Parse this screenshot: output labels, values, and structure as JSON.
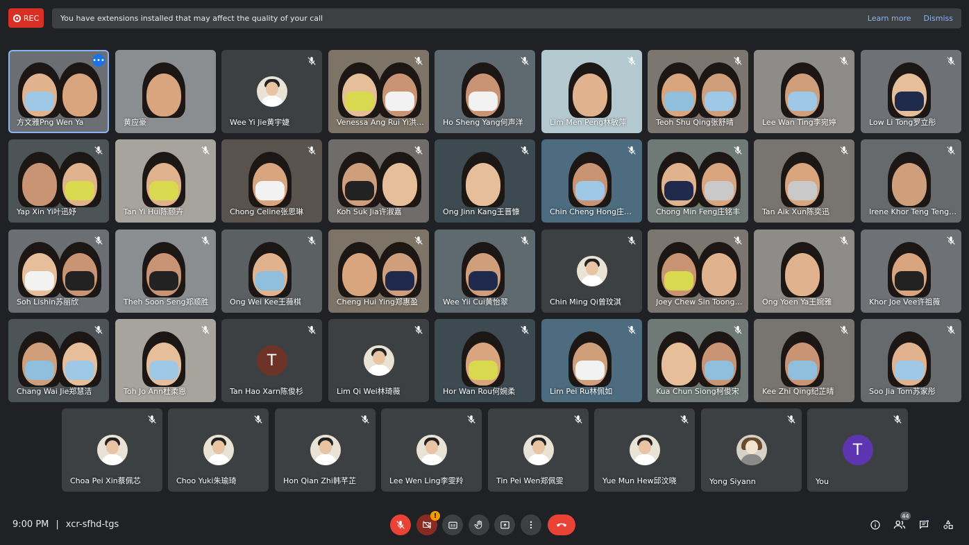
{
  "recording": {
    "label": "REC"
  },
  "banner": {
    "message": "You have extensions installed that may affect the quality of your call",
    "learn_more": "Learn more",
    "dismiss": "Dismiss"
  },
  "participants": [
    "方文雅Png Wen Ya",
    "黄应豪",
    "Wee Yi Jie黄宇婕",
    "Venessa Ang Rui Yi洪芮怡",
    "Ho Sheng Yang何声洋",
    "Lim Men Peng林敏萍",
    "Teoh Shu Qing张舒晴",
    "Lee Wan Ting李宛婷",
    "Low Li Tong罗立彤",
    "Yap Xin Yi叶迅妤",
    "Tan Yi Hui陈颐卉",
    "Chong Celine张思琳",
    "Koh Suk Jia许淑嘉",
    "Ong Jinn Kang王晋慷",
    "Chin Cheng Hong庄承宏",
    "Chong Min Feng庄铭丰",
    "Tan Aik Xun陈奕迅",
    "Irene Khor Teng Teng许婷婷",
    "Soh Lishin苏丽欣",
    "Theh Soon Seng郑顺胜",
    "Ong Wei Kee王薇棋",
    "Cheng Hui Ying郑惠盈",
    "Wee Yii Cui黄怡翠",
    "Chin Ming Qi曾玟淇",
    "Joey Chew Sin Toong周心彤",
    "Ong Yoen Ya王婉雅",
    "Khor Joe Vee许祖薇",
    "Chang Wai Jie郑慧洁",
    "Toh Jo Ann杜柔恩",
    "Tan Hao Xarn陈俊杉",
    "Lim Qi Wei林琦薇",
    "Hor Wan Rou何婉柔",
    "Lim Pei Ru林佩如",
    "Kua Chun Siong柯俊宋",
    "Kee Zhi Qing纪芷晴",
    "Soo Jia Tom苏家彤",
    "Choa Pei Xin蔡佩芯",
    "Choo Yuki朱瑜琦",
    "Hon Qian Zhi韩芊芷",
    "Lee Wen Ling李雯羚",
    "Tin Pei Wen郑佩雯",
    "Yue Mun Hew邱汶晓",
    "Yong Siyann",
    "You"
  ],
  "letter_avatars": {
    "tan_hao_xarn": "T",
    "you": "T"
  },
  "colors": {
    "rec": "#d93025",
    "accent": "#8ab4f8",
    "hangup": "#ea4335",
    "you_avatar": "#5e35b1",
    "tan_avatar": "#6d3326"
  },
  "meeting": {
    "time": "9:00 PM",
    "separator": "|",
    "code": "xcr-sfhd-tgs"
  },
  "controls": [
    "mic-off-icon",
    "camera-off-icon",
    "captions-icon",
    "raise-hand-icon",
    "present-icon",
    "more-options-icon",
    "end-call-icon"
  ],
  "side_controls": {
    "people_count": "44",
    "warning": "!"
  }
}
